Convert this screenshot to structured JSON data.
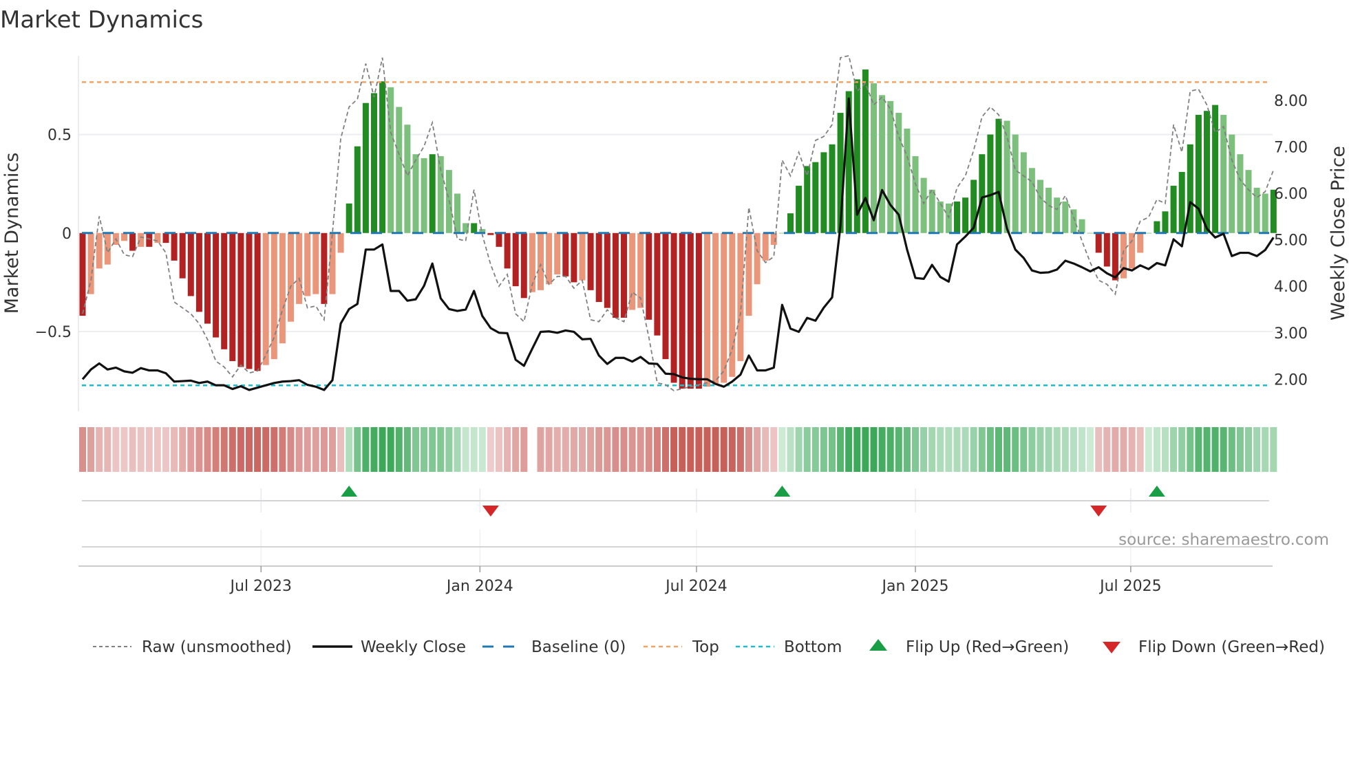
{
  "chart_data": {
    "type": "bar",
    "title": "Market Dynamics",
    "ylabel": "Market Dynamics",
    "y2label": "Weekly Close Price",
    "xlabel": "",
    "start_week": "2023-02-01",
    "frequency": "weekly",
    "ylim": [
      -0.905,
      0.9
    ],
    "y2lim": [
      1.31,
      8.96
    ],
    "yticks": [
      {
        "value": 0.5,
        "label": "0.5"
      },
      {
        "value": 0,
        "label": "0"
      },
      {
        "value": -0.5,
        "label": "−0.5"
      }
    ],
    "y2ticks": [
      {
        "value": 8,
        "label": "8.00"
      },
      {
        "value": 7,
        "label": "7.00"
      },
      {
        "value": 6,
        "label": "6.00"
      },
      {
        "value": 5,
        "label": "5.00"
      },
      {
        "value": 4,
        "label": "4.00"
      },
      {
        "value": 3,
        "label": "3.00"
      },
      {
        "value": 2,
        "label": "2.00"
      }
    ],
    "xticks": [
      {
        "date": "2023-07-01",
        "label": "Jul 2023"
      },
      {
        "date": "2024-01-01",
        "label": "Jan 2024"
      },
      {
        "date": "2024-07-01",
        "label": "Jul 2024"
      },
      {
        "date": "2025-01-01",
        "label": "Jan 2025"
      },
      {
        "date": "2025-07-01",
        "label": "Jul 2025"
      }
    ],
    "top_level": 0.766,
    "bottom_level": -0.773,
    "baseline": 0,
    "grid": true,
    "legend_position": "bottom",
    "series": [
      {
        "name": "Market Dynamics (smoothed)",
        "type": "bar",
        "values": [
          -0.42,
          -0.31,
          -0.18,
          -0.16,
          -0.06,
          -0.04,
          -0.09,
          -0.07,
          -0.07,
          -0.05,
          -0.05,
          -0.14,
          -0.23,
          -0.32,
          -0.4,
          -0.46,
          -0.53,
          -0.59,
          -0.65,
          -0.68,
          -0.69,
          -0.7,
          -0.67,
          -0.64,
          -0.56,
          -0.45,
          -0.36,
          -0.32,
          -0.31,
          -0.36,
          -0.31,
          -0.1,
          0.15,
          0.44,
          0.66,
          0.71,
          0.77,
          0.74,
          0.64,
          0.55,
          0.4,
          0.38,
          0.4,
          0.39,
          0.32,
          0.2,
          0.05,
          0.05,
          0.02,
          -0.01,
          -0.07,
          -0.18,
          -0.27,
          -0.33,
          -0.3,
          -0.29,
          -0.26,
          -0.21,
          -0.22,
          -0.25,
          -0.24,
          -0.29,
          -0.35,
          -0.38,
          -0.43,
          -0.43,
          -0.39,
          -0.38,
          -0.44,
          -0.52,
          -0.64,
          -0.76,
          -0.79,
          -0.79,
          -0.79,
          -0.78,
          -0.77,
          -0.76,
          -0.73,
          -0.65,
          -0.42,
          -0.26,
          -0.14,
          -0.06,
          0.0,
          0.1,
          0.24,
          0.34,
          0.36,
          0.41,
          0.45,
          0.61,
          0.72,
          0.78,
          0.83,
          0.76,
          0.7,
          0.67,
          0.61,
          0.53,
          0.39,
          0.28,
          0.22,
          0.16,
          0.15,
          0.16,
          0.18,
          0.27,
          0.4,
          0.5,
          0.58,
          0.57,
          0.5,
          0.41,
          0.33,
          0.27,
          0.23,
          0.18,
          0.16,
          0.12,
          0.07,
          0.0,
          -0.1,
          -0.17,
          -0.24,
          -0.23,
          -0.18,
          -0.1,
          0.0,
          0.06,
          0.11,
          0.24,
          0.31,
          0.45,
          0.6,
          0.62,
          0.65,
          0.6,
          0.5,
          0.4,
          0.32,
          0.23,
          0.2,
          0.22
        ]
      },
      {
        "name": "Raw (unsmoothed)",
        "type": "line",
        "values": [
          -0.41,
          -0.24,
          0.085,
          -0.1,
          -0.03,
          -0.11,
          -0.12,
          -0.02,
          -0.03,
          -0.04,
          -0.1,
          -0.35,
          -0.38,
          -0.41,
          -0.46,
          -0.54,
          -0.65,
          -0.68,
          -0.73,
          -0.67,
          -0.71,
          -0.7,
          -0.62,
          -0.53,
          -0.39,
          -0.27,
          -0.23,
          -0.38,
          -0.37,
          -0.44,
          0.0,
          0.48,
          0.64,
          0.68,
          0.86,
          0.69,
          0.89,
          0.51,
          0.4,
          0.29,
          0.37,
          0.44,
          0.56,
          0.32,
          0.17,
          -0.03,
          -0.04,
          0.22,
          -0.01,
          -0.16,
          -0.27,
          -0.21,
          -0.41,
          -0.45,
          -0.26,
          -0.16,
          -0.26,
          -0.22,
          -0.22,
          -0.28,
          -0.24,
          -0.44,
          -0.45,
          -0.39,
          -0.43,
          -0.45,
          -0.3,
          -0.33,
          -0.53,
          -0.76,
          -0.77,
          -0.8,
          -0.79,
          -0.78,
          -0.77,
          -0.76,
          -0.75,
          -0.7,
          -0.59,
          -0.41,
          0.13,
          -0.09,
          -0.15,
          -0.12,
          0.37,
          0.29,
          0.41,
          0.29,
          0.47,
          0.49,
          0.55,
          0.89,
          0.9,
          0.72,
          0.76,
          0.65,
          0.69,
          0.63,
          0.49,
          0.39,
          0.25,
          0.15,
          0.22,
          0.15,
          0.08,
          0.23,
          0.29,
          0.42,
          0.59,
          0.64,
          0.6,
          0.49,
          0.32,
          0.29,
          0.26,
          0.18,
          0.14,
          0.12,
          0.19,
          0.08,
          -0.04,
          -0.15,
          -0.24,
          -0.26,
          -0.31,
          -0.09,
          -0.04,
          0.06,
          0.08,
          0.17,
          0.15,
          0.55,
          0.41,
          0.72,
          0.73,
          0.65,
          0.51,
          0.54,
          0.37,
          0.27,
          0.22,
          0.18,
          0.21,
          0.32
        ]
      },
      {
        "name": "Weekly Close",
        "type": "line",
        "axis": "right",
        "values": [
          2.0,
          2.21,
          2.34,
          2.21,
          2.25,
          2.17,
          2.14,
          2.24,
          2.19,
          2.19,
          2.13,
          1.95,
          1.96,
          1.97,
          1.92,
          1.95,
          1.87,
          1.87,
          1.79,
          1.85,
          1.77,
          1.82,
          1.87,
          1.92,
          1.95,
          1.96,
          1.98,
          1.88,
          1.84,
          1.77,
          1.98,
          3.2,
          3.51,
          3.62,
          4.79,
          4.79,
          4.9,
          3.9,
          3.9,
          3.69,
          3.72,
          4.01,
          4.49,
          3.74,
          3.51,
          3.47,
          3.5,
          3.9,
          3.36,
          3.1,
          3.0,
          2.99,
          2.42,
          2.29,
          2.66,
          3.02,
          3.03,
          3.0,
          3.05,
          3.02,
          2.86,
          2.87,
          2.51,
          2.33,
          2.46,
          2.46,
          2.38,
          2.48,
          2.34,
          2.33,
          2.12,
          2.11,
          2.04,
          2.01,
          2.0,
          2.0,
          1.9,
          1.84,
          1.95,
          2.1,
          2.51,
          2.19,
          2.19,
          2.25,
          3.6,
          3.09,
          3.02,
          3.32,
          3.26,
          3.54,
          3.76,
          5.3,
          8.04,
          5.54,
          5.9,
          5.42,
          6.07,
          5.75,
          5.54,
          4.79,
          4.18,
          4.16,
          4.46,
          4.2,
          4.1,
          4.9,
          5.07,
          5.26,
          5.91,
          5.96,
          6.03,
          5.24,
          4.79,
          4.61,
          4.34,
          4.29,
          4.3,
          4.36,
          4.55,
          4.49,
          4.41,
          4.32,
          4.41,
          4.28,
          4.19,
          4.39,
          4.34,
          4.45,
          4.37,
          4.5,
          4.45,
          5.01,
          4.86,
          5.81,
          5.67,
          5.24,
          5.05,
          5.13,
          4.65,
          4.72,
          4.72,
          4.65,
          4.78,
          5.05
        ]
      }
    ],
    "strip_gap_weeks": [
      54
    ],
    "flips": [
      {
        "type": "up",
        "week": 32
      },
      {
        "type": "down",
        "week": 49
      },
      {
        "type": "up",
        "week": 84
      },
      {
        "type": "down",
        "week": 122
      },
      {
        "type": "up",
        "week": 129
      }
    ],
    "legend": [
      {
        "key": "raw",
        "label": "Raw (unsmoothed)"
      },
      {
        "key": "close",
        "label": "Weekly Close"
      },
      {
        "key": "baseline",
        "label": "Baseline (0)"
      },
      {
        "key": "top",
        "label": "Top"
      },
      {
        "key": "bottom",
        "label": "Bottom"
      },
      {
        "key": "flip_up",
        "label": "Flip Up (Red→Green)"
      },
      {
        "key": "flip_down",
        "label": "Flip Down (Green→Red)"
      }
    ],
    "source": "source: sharemaestro.com"
  },
  "colors": {
    "bar_up_strong": "#228b22",
    "bar_up_weak": "#7dbf7d",
    "bar_down_strong": "#b22222",
    "bar_down_weak": "#e9967a",
    "baseline": "#1f77b4",
    "top": "#f4a261",
    "bottom": "#17becf",
    "close": "#111111",
    "raw": "#808080",
    "flip_up": "#1a9e45",
    "flip_down": "#d62728"
  }
}
